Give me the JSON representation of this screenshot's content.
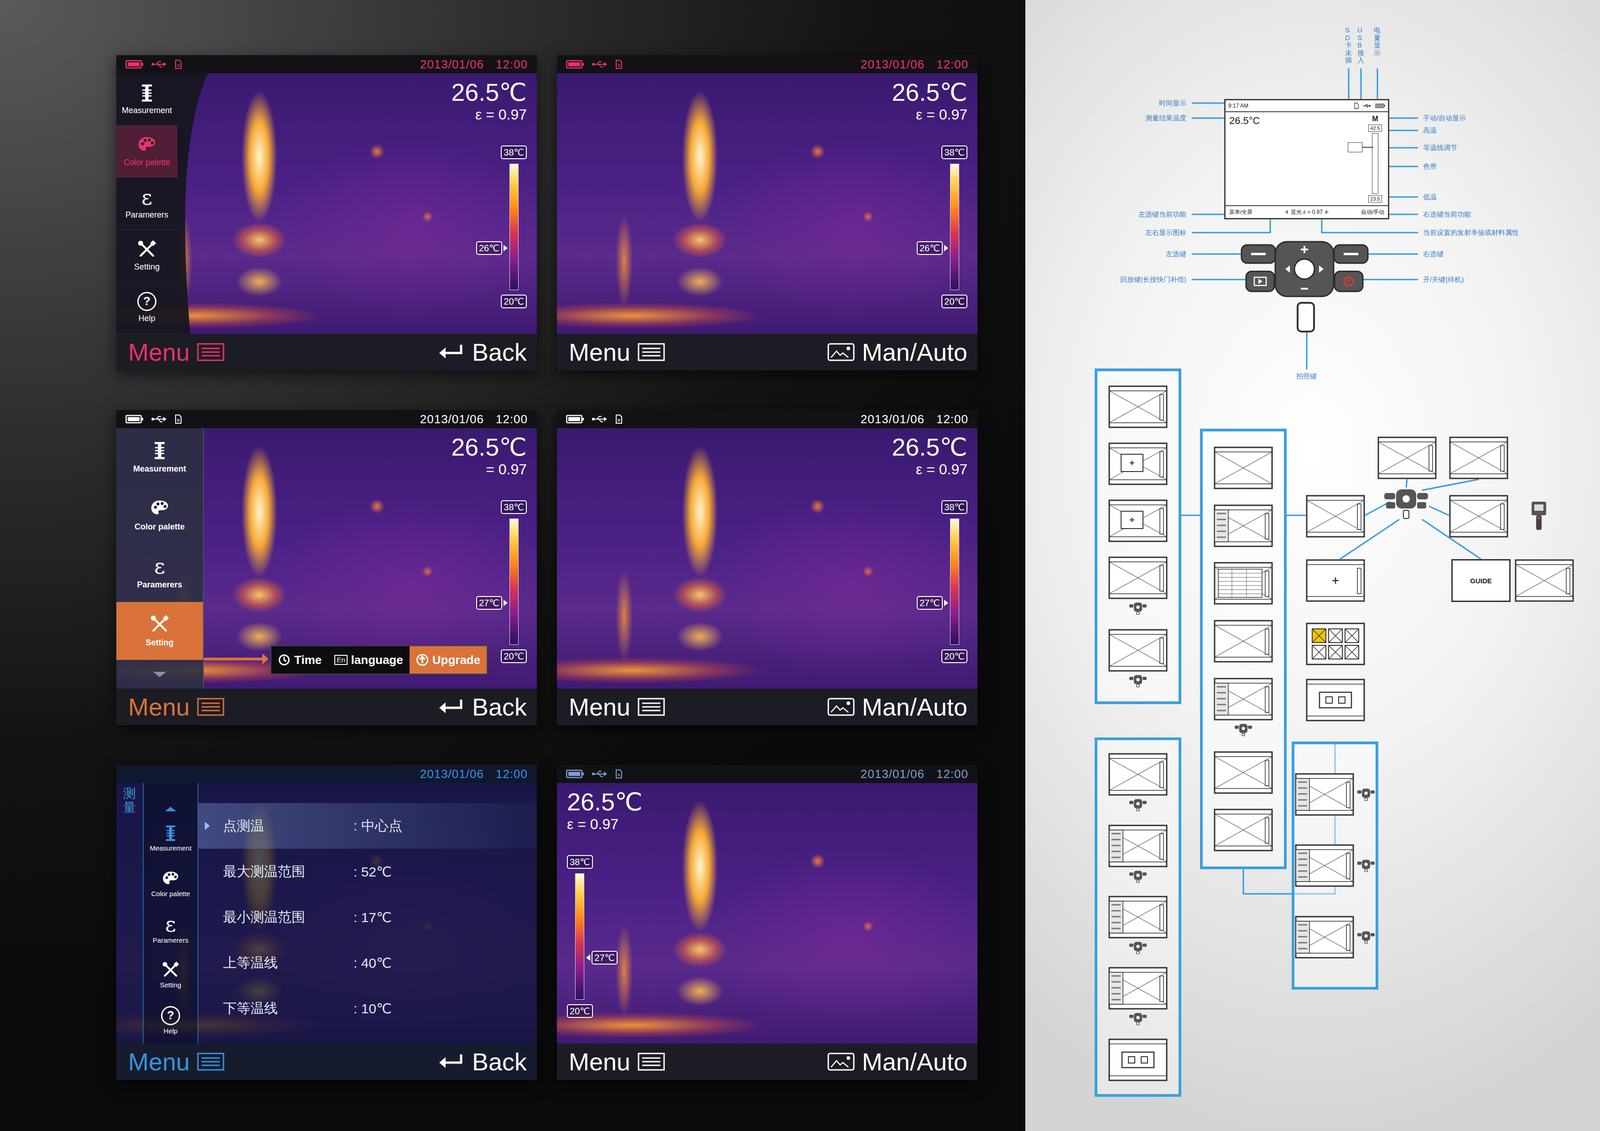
{
  "screens": [
    {
      "kind": "side-menu",
      "color": "#e8336d",
      "status_color": "#e8336d",
      "status_icons": true,
      "date": "2013/01/06",
      "time": "12:00",
      "temperature": "26.5℃",
      "emissivity": "ε = 0.97",
      "scale": {
        "high": "38℃",
        "mid": "26℃",
        "low": "20℃",
        "level": 0.33
      },
      "menu": {
        "label": "Menu",
        "open": true
      },
      "action": {
        "label": "Back",
        "kind": "back"
      },
      "sidebar": [
        {
          "label": "Measurement",
          "kind": "measure",
          "selected": false
        },
        {
          "label": "Color palette",
          "kind": "palette",
          "selected": true
        },
        {
          "label": "Paramerers",
          "kind": "param",
          "glyph": "ε",
          "selected": false
        },
        {
          "label": "Setting",
          "kind": "setting",
          "selected": false
        },
        {
          "label": "Help",
          "kind": "help",
          "glyph": "?",
          "selected": false
        }
      ]
    },
    {
      "kind": "plain",
      "status_color": "#e8336d",
      "status_icons": true,
      "date": "2013/01/06",
      "time": "12:00",
      "temperature": "26.5℃",
      "emissivity": "ε = 0.97",
      "scale": {
        "high": "38℃",
        "mid": "26℃",
        "low": "20℃",
        "level": 0.33
      },
      "menu": {
        "label": "Menu",
        "open": false
      },
      "action": {
        "label": "Man/Auto",
        "kind": "man-auto"
      }
    },
    {
      "kind": "sub-menu",
      "color": "#d9733a",
      "status_color": "#ffffff",
      "status_icons": true,
      "date": "2013/01/06",
      "time": "12:00",
      "temperature": "26.5℃",
      "emissivity": "= 0.97",
      "scale": {
        "high": "38℃",
        "mid": "27℃",
        "low": "20℃",
        "level": 0.33
      },
      "menu": {
        "label": "Menu",
        "open": true
      },
      "action": {
        "label": "Back",
        "kind": "back"
      },
      "sidebar": [
        {
          "label": "Measurement",
          "kind": "measure",
          "selected": false
        },
        {
          "label": "Color palette",
          "kind": "palette",
          "selected": false
        },
        {
          "label": "Paramerers",
          "kind": "param",
          "glyph": "ε",
          "selected": false
        },
        {
          "label": "Setting",
          "kind": "setting",
          "selected": true
        }
      ],
      "submenu": [
        {
          "label": "Time",
          "kind": "clock",
          "selected": false
        },
        {
          "label": "language",
          "kind": "lang",
          "glyph": "En",
          "selected": false
        },
        {
          "label": "Upgrade",
          "kind": "upgrade",
          "selected": true
        }
      ]
    },
    {
      "kind": "plain",
      "status_color": "#ffffff",
      "status_icons": true,
      "date": "2013/01/06",
      "time": "12:00",
      "temperature": "26.5℃",
      "emissivity": "ε = 0.97",
      "scale": {
        "high": "38℃",
        "mid": "27℃",
        "low": "20℃",
        "level": 0.33
      },
      "menu": {
        "label": "Menu",
        "open": false
      },
      "action": {
        "label": "Man/Auto",
        "kind": "man-auto"
      }
    },
    {
      "kind": "list-menu",
      "color": "#3a93dc",
      "status_color": "#3a93dc",
      "status_icons": false,
      "date": "2013/01/06",
      "time": "12:00",
      "menu": {
        "label": "Menu",
        "open": true
      },
      "action": {
        "label": "Back",
        "kind": "back"
      },
      "section": "测量",
      "sidebar": [
        {
          "label": "Measurement",
          "kind": "measure",
          "selected": true
        },
        {
          "label": "Color palette",
          "kind": "palette",
          "selected": false
        },
        {
          "label": "Paramerers",
          "kind": "param",
          "glyph": "ε",
          "selected": false
        },
        {
          "label": "Setting",
          "kind": "setting",
          "selected": false
        },
        {
          "label": "Help",
          "kind": "help",
          "glyph": "?",
          "selected": false
        }
      ],
      "rows": [
        {
          "label": "点测温",
          "value": ": 中心点",
          "selected": true
        },
        {
          "label": "最大测温范围",
          "value": ": 52℃",
          "selected": false
        },
        {
          "label": "最小测温范围",
          "value": ": 17℃",
          "selected": false
        },
        {
          "label": "上等温线",
          "value": ": 40℃",
          "selected": false
        },
        {
          "label": "下等温线",
          "value": ": 10℃",
          "selected": false
        }
      ]
    },
    {
      "kind": "left-scale",
      "status_color": "#7f9fd0",
      "status_icons": true,
      "date": "2013/01/06",
      "time": "12:00",
      "temperature": "26.5℃",
      "emissivity": "ε = 0.97",
      "scale": {
        "high": "38℃",
        "mid": "27℃",
        "low": "20℃",
        "level": 0.33
      },
      "menu": {
        "label": "Menu",
        "open": false
      },
      "action": {
        "label": "Man/Auto",
        "kind": "man-auto"
      }
    }
  ],
  "spec": {
    "screen": {
      "time": "9:17 AM",
      "temperature": "26.5°C",
      "mode": "M",
      "high": "42.5",
      "low": "23.5",
      "left_key": "菜单/全屏",
      "center": "亚光 ε = 0.97",
      "right_key": "自动/手动"
    },
    "left_labels": [
      "时间显示",
      "测量结果温度",
      "左选键当前功能",
      "左右显示图标",
      "左选键",
      "回放键(长按快门补偿)"
    ],
    "right_labels": [
      "手动/自动显示",
      "高温",
      "等温线调节",
      "色带",
      "低温",
      "右选键当前功能",
      "当前设置的发射率值或材料属性",
      "右选键",
      "开/关键(待机)"
    ],
    "top_labels": [
      "SD卡未插",
      "USB接入",
      "电量显示"
    ],
    "bottom_label": "拍照键"
  },
  "flow": {
    "groups": [
      {
        "thumbs": [
          {
            "kind": "screen",
            "with_keypad": false
          },
          {
            "kind": "screen-box",
            "with_keypad": false
          },
          {
            "kind": "screen-box",
            "with_keypad": false
          },
          {
            "kind": "screen",
            "with_keypad": true
          },
          {
            "kind": "screen",
            "with_keypad": true
          }
        ]
      },
      {
        "thumbs": [
          {
            "kind": "blank",
            "with_keypad": false
          },
          {
            "kind": "menu",
            "with_keypad": false
          },
          {
            "kind": "table",
            "with_keypad": false
          },
          {
            "kind": "screen",
            "with_keypad": false
          },
          {
            "kind": "menu",
            "with_keypad": true
          },
          {
            "kind": "screen",
            "with_keypad": false
          },
          {
            "kind": "screen",
            "with_keypad": false
          }
        ]
      },
      {
        "thumbs": [
          {
            "kind": "screen",
            "with_keypad": true
          },
          {
            "kind": "menu",
            "with_keypad": true
          },
          {
            "kind": "menu",
            "with_keypad": true
          },
          {
            "kind": "menu",
            "with_keypad": true
          },
          {
            "kind": "dialog",
            "with_keypad": false
          }
        ]
      },
      {
        "thumbs": [
          {
            "kind": "menu",
            "with_keypad": true
          },
          {
            "kind": "menu",
            "with_keypad": true
          },
          {
            "kind": "menu",
            "with_keypad": true
          }
        ]
      }
    ],
    "nodes": [
      {
        "kind": "screen"
      },
      {
        "kind": "screen"
      },
      {
        "kind": "screen"
      },
      {
        "kind": "screen"
      },
      {
        "kind": "cross"
      },
      {
        "kind": "grid"
      },
      {
        "kind": "dialog"
      },
      {
        "kind": "keypad"
      },
      {
        "kind": "guide",
        "label": "GUIDE"
      },
      {
        "kind": "screen"
      },
      {
        "kind": "device"
      }
    ]
  }
}
